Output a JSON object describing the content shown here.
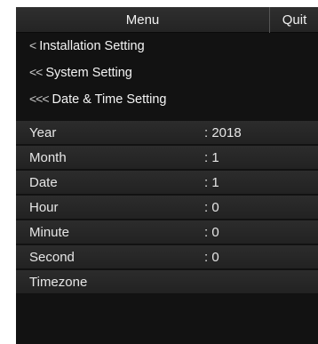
{
  "header": {
    "title": "Menu",
    "quit_label": "Quit"
  },
  "breadcrumbs": [
    {
      "chevron": "<",
      "label": "Installation Setting"
    },
    {
      "chevron": "<<",
      "label": "System Setting"
    },
    {
      "chevron": "<<<",
      "label": "Date & Time Setting"
    }
  ],
  "settings": [
    {
      "label": "Year",
      "value": ": 2018"
    },
    {
      "label": "Month",
      "value": ": 1"
    },
    {
      "label": "Date",
      "value": ": 1"
    },
    {
      "label": "Hour",
      "value": ": 0"
    },
    {
      "label": "Minute",
      "value": ": 0"
    },
    {
      "label": "Second",
      "value": ": 0"
    },
    {
      "label": "Timezone",
      "value": ""
    }
  ],
  "colors": {
    "panel_background": "#121212",
    "row_background": "#2a2a2a",
    "text": "#f2f2f2"
  }
}
